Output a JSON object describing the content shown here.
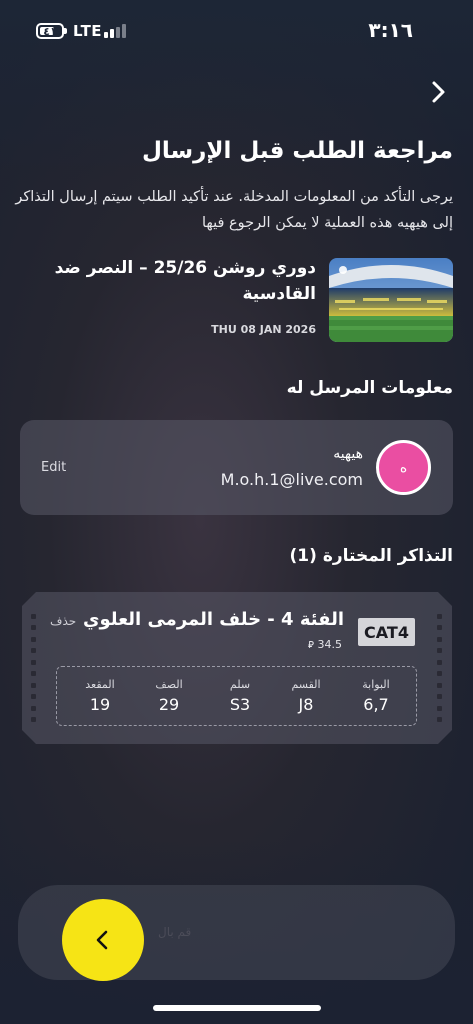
{
  "status_bar": {
    "battery": "٤١",
    "network": "LTE",
    "time": "٣:١٦"
  },
  "page": {
    "title": "مراجعة الطلب قبل الإرسال",
    "description": "يرجى التأكد من المعلومات المدخلة. عند تأكيد الطلب سيتم إرسال التذاكر إلى هيهيه هذه العملية لا يمكن الرجوع فيها"
  },
  "event": {
    "name": "دوري روشن 25/26 – النصر ضد القادسية",
    "date": "THU 08 JAN 2026",
    "image_icon": "stadium-image"
  },
  "recipient_section": {
    "title": "معلومات المرسل له",
    "avatar_initial": "ه",
    "name": "هيهيه",
    "email": "M.o.h.1@live.com",
    "edit_label": "Edit"
  },
  "tickets_section": {
    "title": "التذاكر المختارة (1)",
    "ticket": {
      "category_badge": "CAT4",
      "title": "الفئة 4 - خلف المرمى العلوي",
      "price": "34.5",
      "currency_icon": "riyal-icon",
      "delete_label": "حذف",
      "details": [
        {
          "label": "البوابة",
          "value": "6,7"
        },
        {
          "label": "القسم",
          "value": "J8"
        },
        {
          "label": "سلم",
          "value": "S3"
        },
        {
          "label": "الصف",
          "value": "29"
        },
        {
          "label": "المقعد",
          "value": "19"
        }
      ]
    }
  },
  "bottom_bar": {
    "hint": "قم بال",
    "knob_icon": "chevron-left-icon",
    "knob_color": "#f6e415"
  },
  "colors": {
    "avatar": "#ea4ea2",
    "badge": "#d5d5d9"
  }
}
